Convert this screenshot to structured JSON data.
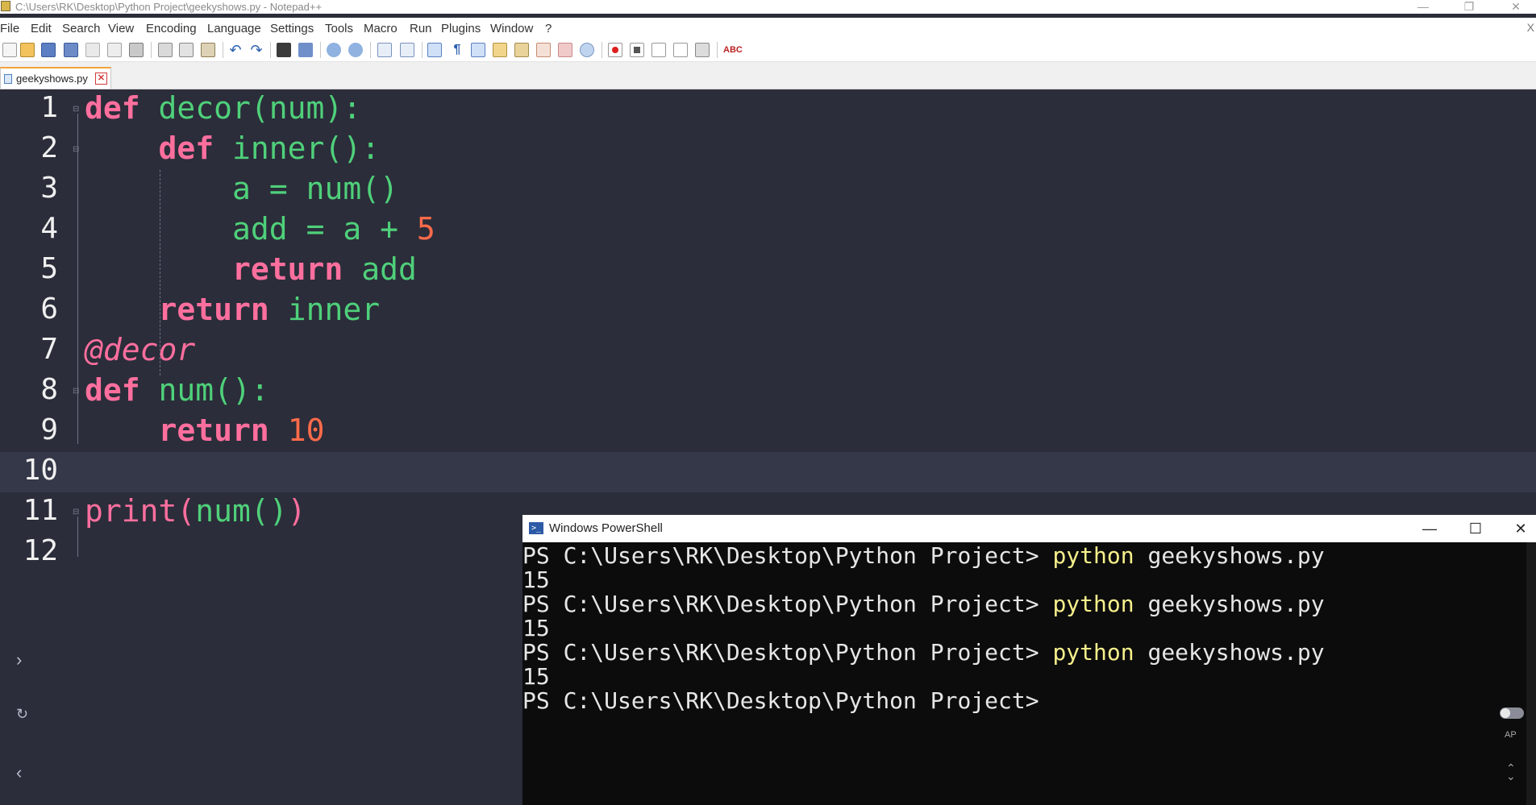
{
  "window": {
    "title": "C:\\Users\\RK\\Desktop\\Python Project\\geekyshows.py - Notepad++",
    "minimize": "—",
    "restore": "❐",
    "close": "✕"
  },
  "menu": {
    "items": [
      "File",
      "Edit",
      "Search",
      "View",
      "Encoding",
      "Language",
      "Settings",
      "Tools",
      "Macro",
      "Run",
      "Plugins",
      "Window",
      "?"
    ],
    "close": "X"
  },
  "tab": {
    "label": "geekyshows.py",
    "close": "✕"
  },
  "editor": {
    "line_numbers": [
      "1",
      "2",
      "3",
      "4",
      "5",
      "6",
      "7",
      "8",
      "9",
      "10",
      "11",
      "12"
    ],
    "current_line": 10
  },
  "side_buttons": {
    "expand": "›",
    "refresh": "↻",
    "back": "‹"
  },
  "powershell": {
    "title": "Windows PowerShell",
    "minimize": "—",
    "maximize": "☐",
    "close": "✕",
    "prompt": "PS C:\\Users\\RK\\Desktop\\Python Project> ",
    "command": "python",
    "argument": " geekyshows.py",
    "output": "15",
    "final_prompt": "PS C:\\Users\\RK\\Desktop\\Python Project>"
  },
  "widget": {
    "label": "AP"
  },
  "colors": {
    "editor_bg": "#2b2d3a",
    "keyword": "#ff6f9e",
    "identifier": "#4fd07a",
    "number": "#ff6b4a",
    "console_bg": "#0c0c0c",
    "console_command": "#f7f08c"
  }
}
